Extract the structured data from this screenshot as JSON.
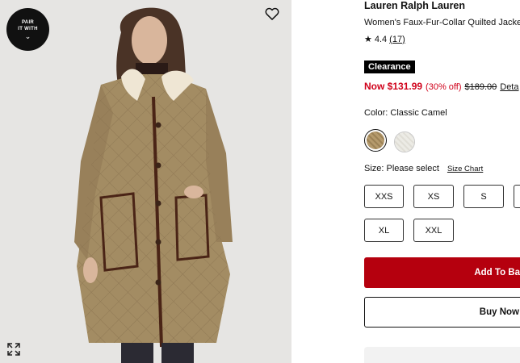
{
  "image": {
    "pair_badge": {
      "line1": "PAIR",
      "line2": "IT WITH",
      "chevron": "⌄"
    },
    "icons": {
      "heart": "heart-icon",
      "expand": "expand-icon"
    }
  },
  "product": {
    "brand": "Lauren Ralph Lauren",
    "name": "Women's Faux-Fur-Collar Quilted Jacket",
    "rating": {
      "star": "★",
      "value": "4.4",
      "count": "(17)"
    },
    "badge": "Clearance",
    "price": {
      "now": "Now $131.99",
      "percent_off": "(30% off)",
      "original": "$189.00",
      "details_link": "Deta"
    },
    "color": {
      "label": "Color: Classic Camel",
      "selected": "Classic Camel"
    },
    "size": {
      "label": "Size: Please select",
      "chart_link": "Size Chart",
      "options": [
        "XXS",
        "XS",
        "S",
        "",
        "XL",
        "XXL"
      ]
    },
    "buttons": {
      "add_to_bag": "Add To Ba",
      "buy_now": "Buy Now"
    }
  },
  "colors": {
    "sale_red": "#d0021b",
    "add_to_bag_bg": "#b5000e",
    "camel": "#a38c63"
  }
}
